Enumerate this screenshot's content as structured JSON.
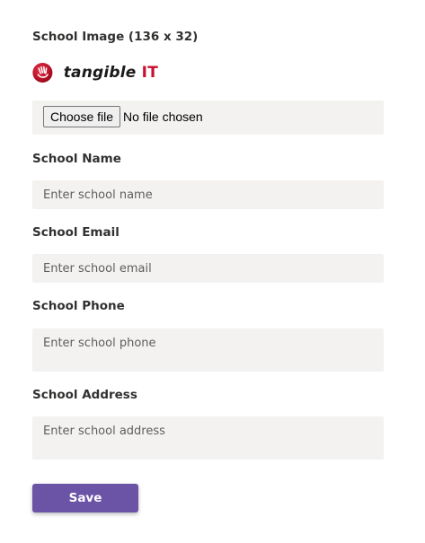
{
  "school_image": {
    "label": "School Image (136 x 32)",
    "logo_text": "tangible",
    "logo_accent": "IT",
    "file_button_label": "Choose file",
    "file_status": "No file chosen"
  },
  "school_name": {
    "label": "School Name",
    "placeholder": "Enter school name"
  },
  "school_email": {
    "label": "School Email",
    "placeholder": "Enter school email"
  },
  "school_phone": {
    "label": "School Phone",
    "placeholder": "Enter school phone"
  },
  "school_address": {
    "label": "School Address",
    "placeholder": "Enter school address"
  },
  "save_label": "Save",
  "colors": {
    "accent": "#6b53a6",
    "field_background": "#f3f2f1",
    "logo_red": "#c8102e"
  }
}
